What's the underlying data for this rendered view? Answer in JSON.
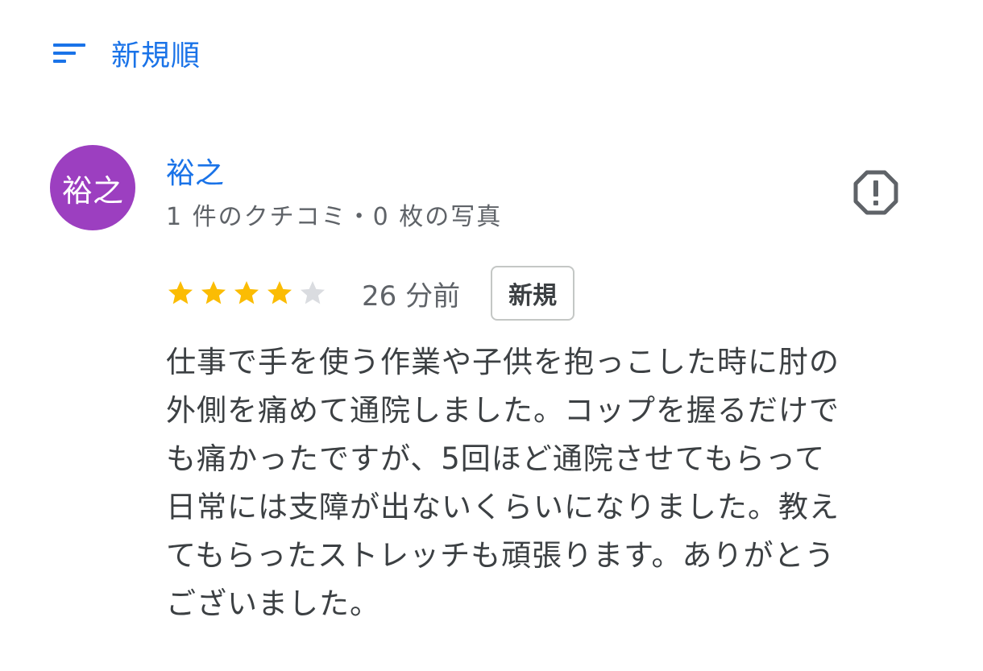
{
  "sort": {
    "icon": "sort-lines-icon",
    "label": "新規順"
  },
  "review": {
    "avatar_text": "裕之",
    "avatar_color": "#9c3fc0",
    "author_name": "裕之",
    "author_meta": "1 件のクチコミ・0 枚の写真",
    "report_icon": "report-octagon-icon",
    "rating": 4,
    "rating_max": 5,
    "star_color": "#fbbc04",
    "star_empty_color": "#dadce0",
    "time": "26 分前",
    "badge": "新規",
    "text_lines": [
      "仕事で手を使う作業や子供を抱っこした時に肘の",
      "外側を痛めて通院しました。コップを握るだけで",
      "も痛かったですが、5回ほど通院させてもらって",
      "日常には支障が出ないくらいになりました。教え",
      "てもらったストレッチも頑張ります。ありがとう",
      "ございました。"
    ]
  },
  "colors": {
    "accent": "#1a73e8",
    "secondary_text": "#5f6368",
    "body_text": "#3c4043"
  }
}
